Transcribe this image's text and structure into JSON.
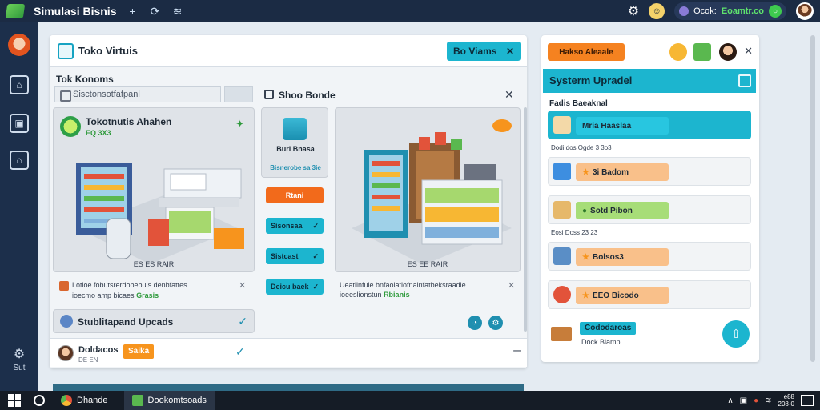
{
  "app": {
    "title": "Simulasi Bisnis",
    "accent": "#1cb5cf",
    "orange": "#f58220",
    "titlebar_icons": [
      "plus-icon",
      "refresh-icon",
      "wifi-icon"
    ]
  },
  "topbar": {
    "user_label": "Ocok:",
    "user_value": "Eoamtr.co"
  },
  "rail": {
    "bottom_label": "Sut"
  },
  "panel": {
    "title": "Toko Virtuis",
    "action_label": "Bo Viams",
    "section_label": "Tok Konoms",
    "search_placeholder": "Sisctonsotfafpanl",
    "card1": {
      "title": "Tokotnutis Ahahen",
      "subtitle": "EQ 3X3",
      "caption": "ES ES RAIR"
    },
    "desc1": {
      "line1": "Lotioe fobutsrerdobebuis denbfattes",
      "line2": "ioecmo amp bicaes",
      "highlight": "Grasis"
    },
    "upgrade_label": "Stublitapand Upcads",
    "bottom_row": {
      "name": "Doldacos",
      "sub": "DE EN",
      "tag": "Saika"
    },
    "middle": {
      "header": "Shoo Bonde",
      "tile_label": "Buri Bnasa",
      "tile_sub": "Bisnerobe sa 3ie",
      "buttons": [
        "Rtani",
        "Sisonsaa",
        "Sistcast",
        "Deicu baek"
      ]
    },
    "card2": {
      "caption": "ES EE RAIR"
    },
    "desc2": {
      "line1": "Ueatlinfule bnfaoiatlofnalnfatbeksraadie",
      "line2": "ioeeslionstun",
      "highlight": "Rbianis"
    }
  },
  "right_panel": {
    "action_label": "Hakso Aleaale",
    "banner": "Systerm Upradel",
    "section_label": "Fadis Baeaknal",
    "rows": [
      {
        "label": "Mria Haaslaa",
        "meta": "Dodi dos Ogde 3 3o3",
        "color": "#1cb5cf"
      },
      {
        "label": "3i Badom",
        "meta": "",
        "color": "#f9c08a"
      },
      {
        "label": "Sotd Pibon",
        "meta": "Eosi Doss 23 23",
        "color": "#a7dd78"
      },
      {
        "label": "Bolsos3",
        "meta": "",
        "color": "#f9c08a"
      },
      {
        "label": "EEO Bicodo",
        "meta": "",
        "color": "#f9c08a"
      }
    ],
    "bottom": {
      "pill": "Cododaroas",
      "sub": "Dock Blamp"
    }
  },
  "taskbar": {
    "tasks": [
      "Dhande",
      "Dookomtsoads"
    ],
    "time": "e88",
    "date": "208-0"
  }
}
